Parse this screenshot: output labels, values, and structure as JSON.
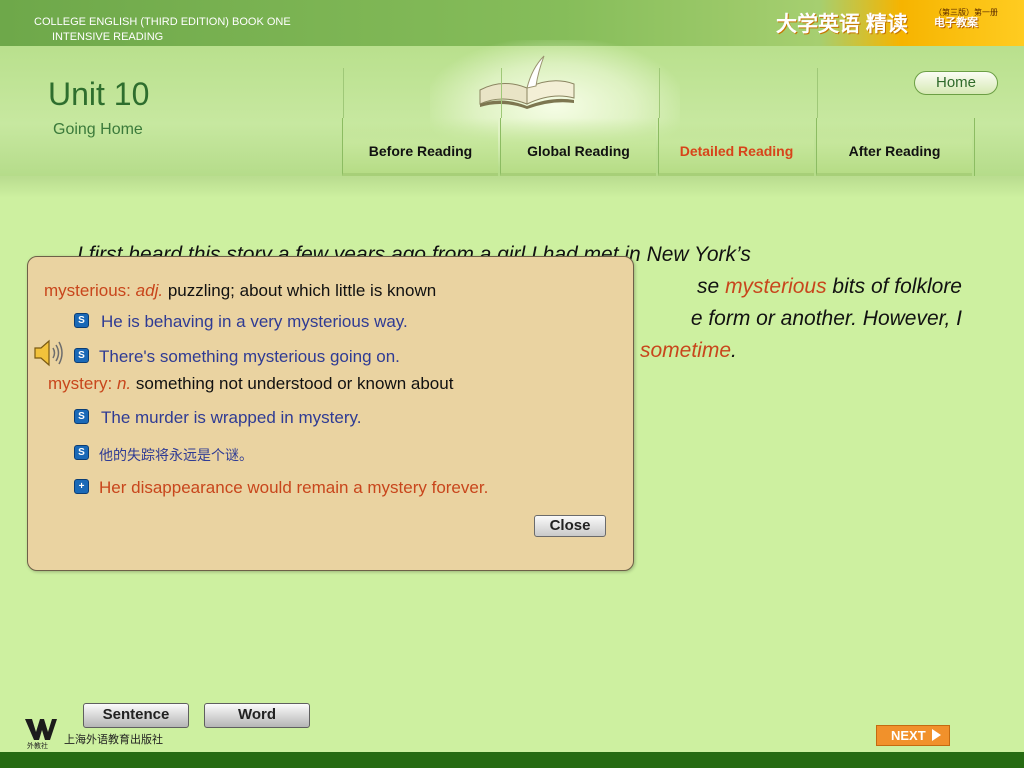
{
  "header": {
    "course_line1": "COLLEGE ENGLISH (THIRD EDITION)   BOOK  ONE",
    "course_line2": "INTENSIVE READING",
    "cn_title": "大学英语 精读",
    "cn_edition": "（第三版）第一册",
    "cn_sub": "电子教案",
    "home_label": "Home"
  },
  "unit": {
    "title": "Unit 10",
    "subtitle": "Going Home"
  },
  "tabs": [
    {
      "label": "Before Reading",
      "active": false
    },
    {
      "label": "Global Reading",
      "active": false
    },
    {
      "label": "Detailed Reading",
      "active": true
    },
    {
      "label": "After Reading",
      "active": false
    }
  ],
  "reading": {
    "line1": "I first heard this story a few years ago from a girl I had met in New York’s",
    "line2_pre": "se ",
    "line2_hl": "mysterious",
    "line2_post": " bits of folklore",
    "line3": "e form or another. However, I",
    "line4_hl": "sometime",
    "line4_post": "."
  },
  "popup": {
    "entry1": {
      "word": "mysterious:",
      "pos": "adj.",
      "def": "puzzling; about which little is known"
    },
    "ex1": "He is behaving in a very mysterious way.",
    "ex2": "There's something mysterious going on.",
    "entry2": {
      "word": "mystery:",
      "pos": "n.",
      "def": "something not understood or known about"
    },
    "ex3": "The murder is wrapped in mystery.",
    "ex4": "他的失踪将永远是个谜。",
    "ex5": "Her disappearance would remain a mystery forever.",
    "close_label": "Close"
  },
  "bottom": {
    "sentence_label": "Sentence",
    "word_label": "Word",
    "logo_text": "外教社",
    "publisher": "上海外语教育出版社",
    "next_label": "NEXT"
  },
  "colors": {
    "highlight": "#c8461c",
    "example_blue": "#2f3b94",
    "active_tab": "#d7441a",
    "background": "#cdf0a0",
    "popup_bg": "#ead3a1"
  }
}
